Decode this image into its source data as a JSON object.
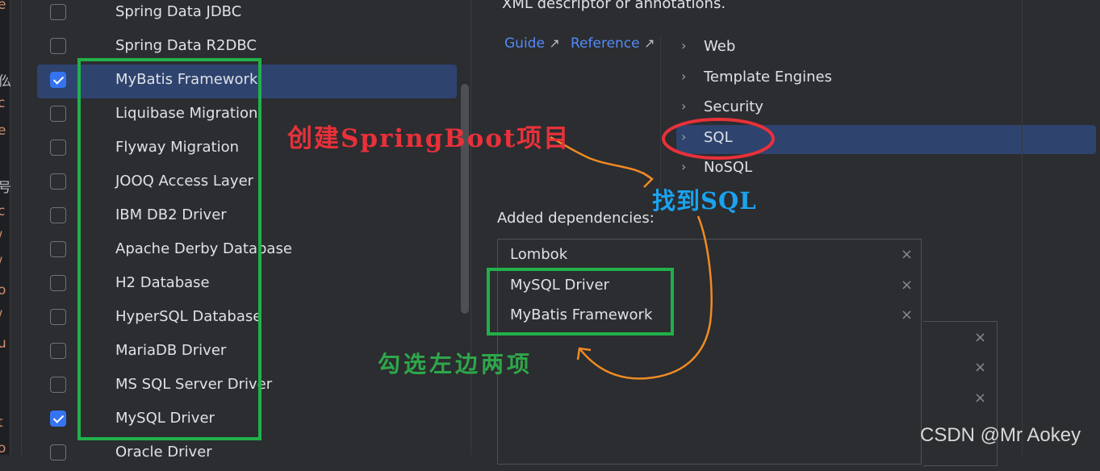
{
  "edge_glyphs": [
    "e",
    "仫",
    "c",
    "e",
    "号",
    "c",
    "/",
    "/",
    "o",
    "/",
    "u",
    "t",
    "o"
  ],
  "dependencies": [
    {
      "label": "Spring Data JDBC",
      "checked": false,
      "selected": false
    },
    {
      "label": "Spring Data R2DBC",
      "checked": false,
      "selected": false
    },
    {
      "label": "MyBatis Framework",
      "checked": true,
      "selected": true
    },
    {
      "label": "Liquibase Migration",
      "checked": false,
      "selected": false
    },
    {
      "label": "Flyway Migration",
      "checked": false,
      "selected": false
    },
    {
      "label": "JOOQ Access Layer",
      "checked": false,
      "selected": false
    },
    {
      "label": "IBM DB2 Driver",
      "checked": false,
      "selected": false
    },
    {
      "label": "Apache Derby Database",
      "checked": false,
      "selected": false
    },
    {
      "label": "H2 Database",
      "checked": false,
      "selected": false
    },
    {
      "label": "HyperSQL Database",
      "checked": false,
      "selected": false
    },
    {
      "label": "MariaDB Driver",
      "checked": false,
      "selected": false
    },
    {
      "label": "MS SQL Server Driver",
      "checked": false,
      "selected": false
    },
    {
      "label": "MySQL Driver",
      "checked": true,
      "selected": false
    },
    {
      "label": "Oracle Driver",
      "checked": false,
      "selected": false
    }
  ],
  "description": {
    "text": "XML descriptor or annotations.",
    "guide_label": "Guide",
    "reference_label": "Reference",
    "external_arrow": "↗"
  },
  "categories": [
    {
      "label": "Web",
      "selected": false
    },
    {
      "label": "Template Engines",
      "selected": false
    },
    {
      "label": "Security",
      "selected": false
    },
    {
      "label": "SQL",
      "selected": true
    },
    {
      "label": "NoSQL",
      "selected": false
    }
  ],
  "chevron": "›",
  "added": {
    "title": "Added dependencies:",
    "items": [
      "Lombok",
      "MySQL Driver",
      "MyBatis Framework"
    ],
    "remove_glyph": "×"
  },
  "annotations": {
    "create_project": "创建SpringBoot项目",
    "find_sql": "找到SQL",
    "check_left_two": "勾选左边两项",
    "colors": {
      "red": "#e8313a",
      "blue": "#1aa3f0",
      "green": "#2ea64a",
      "orange": "#f08a24"
    }
  },
  "watermark": "CSDN @Mr  Aokey",
  "colors": {
    "background": "#2b2d30",
    "selection": "#2e436e",
    "checkbox_accent": "#3574f0",
    "link": "#548af7"
  }
}
